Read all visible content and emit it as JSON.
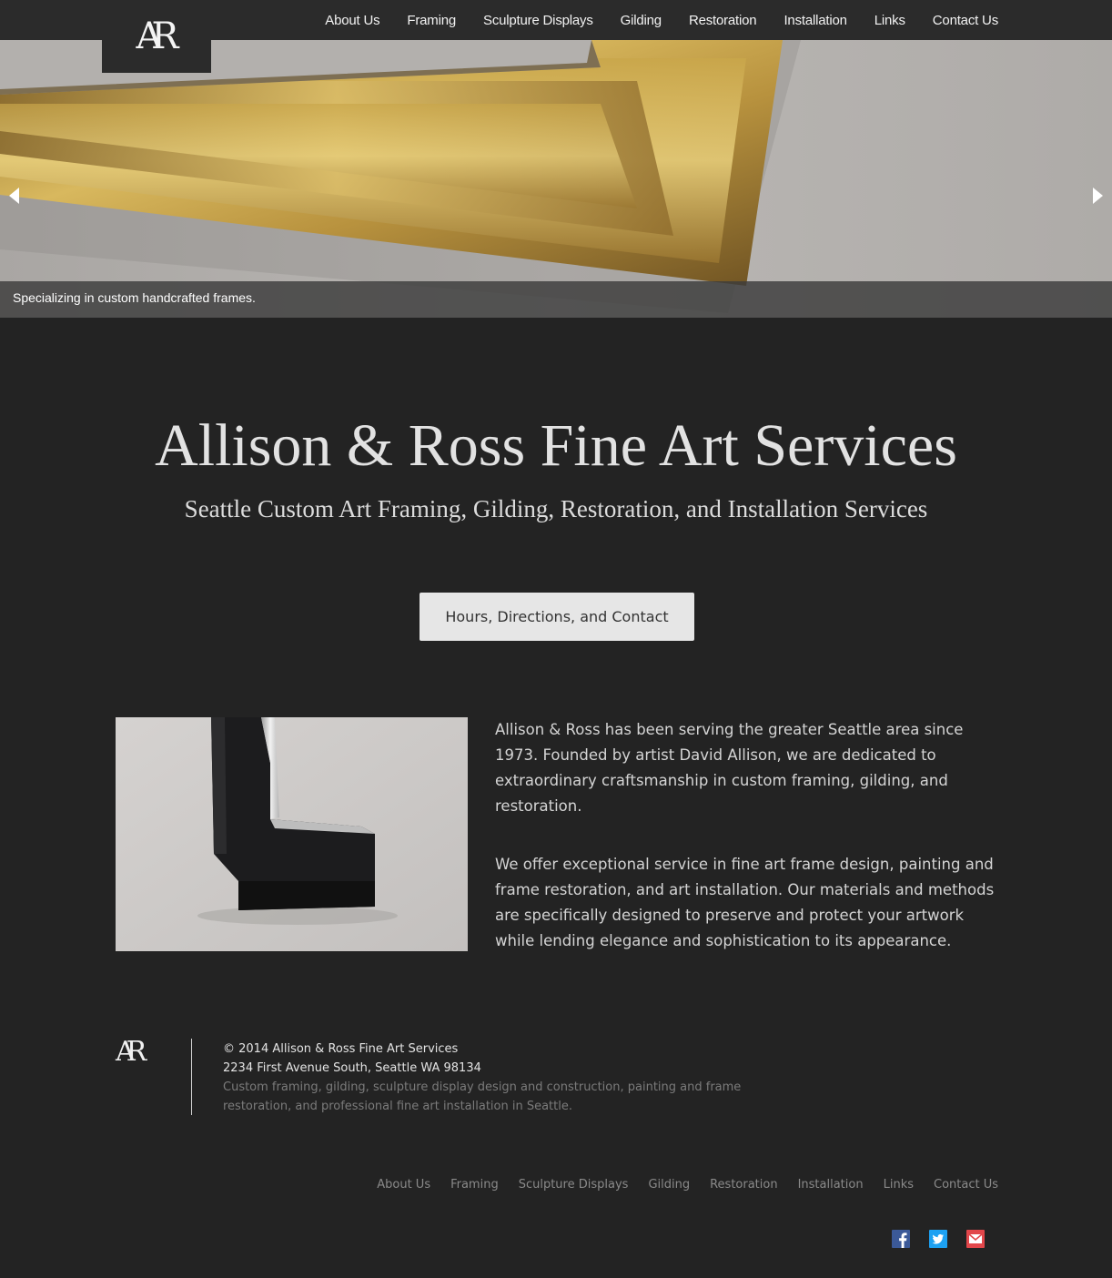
{
  "header": {
    "logo_text": "AR",
    "nav": [
      "About Us",
      "Framing",
      "Sculpture Displays",
      "Gilding",
      "Restoration",
      "Installation",
      "Links",
      "Contact Us"
    ]
  },
  "hero": {
    "caption": "Specializing in custom handcrafted frames."
  },
  "main": {
    "title": "Allison & Ross Fine Art Services",
    "subtitle": "Seattle Custom Art Framing, Gilding, Restoration, and Installation Services",
    "cta_label": "Hours, Directions, and Contact",
    "paragraphs": [
      "Allison & Ross has been serving the greater Seattle area since 1973. Founded by artist David Allison, we are dedicated to extraordinary craftsmanship in custom framing, gilding, and restoration.",
      "We offer exceptional service in fine art frame design, painting and frame restoration, and art installation. Our materials and methods are specifically designed to preserve and protect your artwork while lending elegance and sophistication to its appearance."
    ]
  },
  "footer": {
    "logo_text": "AR",
    "copyright": "© 2014 Allison & Ross Fine Art Services",
    "address": "2234 First Avenue South, Seattle WA 98134",
    "description": "Custom framing, gilding, sculpture display design and construction, painting and frame restoration, and professional fine art installation in Seattle.",
    "nav": [
      "About Us",
      "Framing",
      "Sculpture Displays",
      "Gilding",
      "Restoration",
      "Installation",
      "Links",
      "Contact Us"
    ],
    "social": [
      "facebook-icon",
      "twitter-icon",
      "email-icon"
    ]
  },
  "colors": {
    "background": "#232323",
    "nav_bar": "#2b2b2b",
    "gold": "#c9a64a",
    "facebook": "#3b5998",
    "twitter": "#1da1f2",
    "email": "#e2474b"
  }
}
